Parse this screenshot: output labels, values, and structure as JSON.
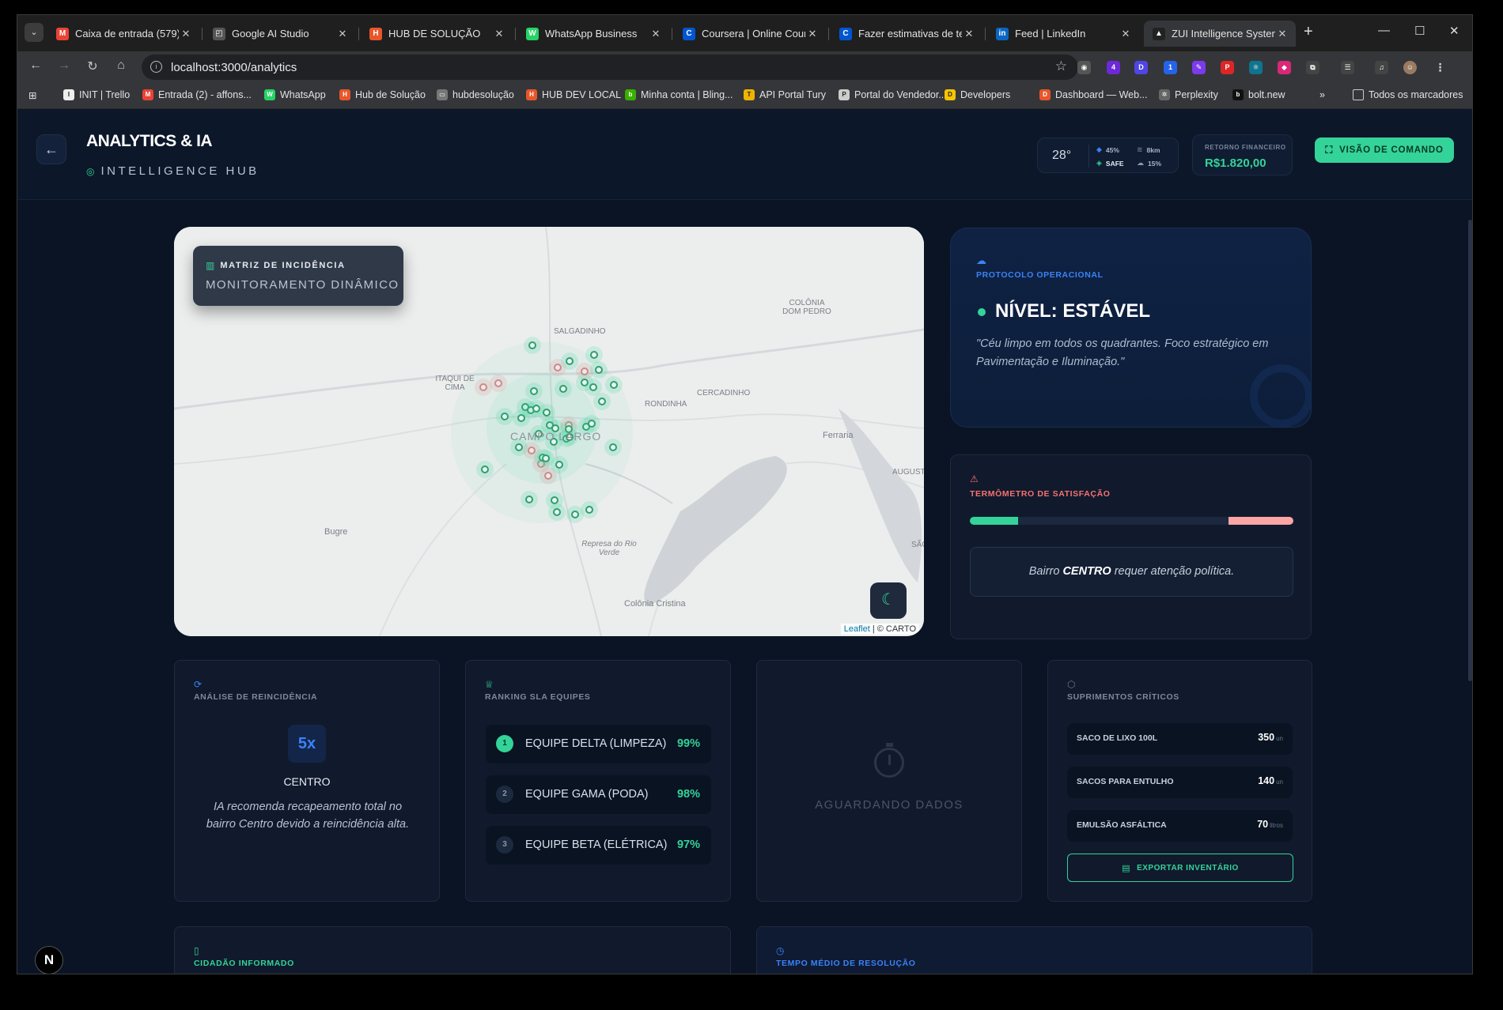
{
  "browser": {
    "tabs": [
      {
        "label": "Caixa de entrada (579)",
        "icon": "gmail-icon",
        "color": "#ea4335",
        "glyph": "M"
      },
      {
        "label": "Google AI Studio",
        "icon": "ai-studio-icon",
        "color": "#555555",
        "glyph": "◰"
      },
      {
        "label": "HUB DE SOLUÇÃO",
        "icon": "hub-icon",
        "color": "#e8562a",
        "glyph": "H"
      },
      {
        "label": "WhatsApp Business",
        "icon": "whatsapp-icon",
        "color": "#25d366",
        "glyph": "W"
      },
      {
        "label": "Coursera | Online Cours",
        "icon": "coursera-icon",
        "color": "#0056d2",
        "glyph": "C"
      },
      {
        "label": "Fazer estimativas de ter",
        "icon": "coursera-icon",
        "color": "#0056d2",
        "glyph": "C"
      },
      {
        "label": "Feed | LinkedIn",
        "icon": "linkedin-icon",
        "color": "#0a66c2",
        "glyph": "in"
      },
      {
        "label": "ZUI Intelligence System",
        "icon": "zui-icon",
        "color": "#222222",
        "glyph": "▲"
      }
    ],
    "url": "localhost:3000/analytics",
    "bookmarks": [
      {
        "label": "INIT | Trello",
        "color": "#eeeeee",
        "glyph": "I"
      },
      {
        "label": "Entrada (2) - affons...",
        "color": "#ea4335",
        "glyph": "M"
      },
      {
        "label": "WhatsApp",
        "color": "#25d366",
        "glyph": "W"
      },
      {
        "label": "Hub de Solução",
        "color": "#e8562a",
        "glyph": "H"
      },
      {
        "label": "hubdesolução",
        "color": "#777777",
        "glyph": "▭"
      },
      {
        "label": "HUB DEV LOCAL",
        "color": "#e8562a",
        "glyph": "H"
      },
      {
        "label": "Minha conta | Bling...",
        "color": "#38b000",
        "glyph": "b"
      },
      {
        "label": "API Portal Tury",
        "color": "#f0b400",
        "glyph": "T"
      },
      {
        "label": "Portal do Vendedor...",
        "color": "#cccccc",
        "glyph": "P"
      },
      {
        "label": "Developers",
        "color": "#f5c400",
        "glyph": "D"
      },
      {
        "label": "Dashboard — Web...",
        "color": "#e8562a",
        "glyph": "D"
      },
      {
        "label": "Perplexity",
        "color": "#666666",
        "glyph": "✲"
      },
      {
        "label": "bolt.new",
        "color": "#111111",
        "glyph": "b"
      }
    ],
    "more_bookmarks": "»",
    "all_bookmarks": "Todos os marcadores"
  },
  "header": {
    "title": "ANALYTICS & IA",
    "subtitle": "INTELLIGENCE HUB",
    "weather": {
      "temp": "28°",
      "humidity": "45%",
      "status": "SAFE",
      "wind": "8km",
      "rain": "15%"
    },
    "finance_label": "RETORNO FINANCEIRO",
    "finance_value": "R$1.820,00",
    "command_button": "VISÃO DE COMANDO"
  },
  "map": {
    "tag": "MATRIZ DE INCIDÊNCIA",
    "title": "MONITORAMENTO DINÂMICO",
    "places": [
      "SALGADINHO",
      "ITAQUI DE CIMA",
      "COLÔNIA DOM PEDRO",
      "CERCADINHO",
      "RONDINHA",
      "CAMPO LARGO",
      "Ferraria",
      "AUGUST",
      "SÃO",
      "Bugre",
      "Represa do Rio Verde",
      "Colônia Cristina"
    ],
    "attribution_link": "Leaflet",
    "attribution_rest": " | © CARTO"
  },
  "protocol": {
    "label": "PROTOCOLO OPERACIONAL",
    "level": "NÍVEL: ESTÁVEL",
    "quote": "\"Céu limpo em todos os quadrantes. Foco estratégico em Pavimentação e Iluminação.\""
  },
  "satisfaction": {
    "label": "TERMÔMETRO DE SATISFAÇÃO",
    "positive_fraction": 0.15,
    "negative_fraction": 0.2,
    "note_pre": "Bairro ",
    "note_bold": "CENTRO",
    "note_post": " requer atenção política."
  },
  "reincidence": {
    "label": "ANÁLISE DE REINCIDÊNCIA",
    "badge": "5x",
    "place": "CENTRO",
    "text": "IA recomenda recapeamento total no bairro Centro devido a reincidência alta."
  },
  "ranking": {
    "label": "RANKING SLA EQUIPES",
    "items": [
      {
        "pos": "1",
        "name": "EQUIPE DELTA (LIMPEZA)",
        "value": "99%"
      },
      {
        "pos": "2",
        "name": "EQUIPE GAMA (PODA)",
        "value": "98%"
      },
      {
        "pos": "3",
        "name": "EQUIPE BETA (ELÉTRICA)",
        "value": "97%"
      }
    ]
  },
  "awaiting": {
    "text": "AGUARDANDO DADOS"
  },
  "supplies": {
    "label": "SUPRIMENTOS CRÍTICOS",
    "items": [
      {
        "name": "SACO DE LIXO 100L",
        "value": "350",
        "unit": "un"
      },
      {
        "name": "SACOS PARA ENTULHO",
        "value": "140",
        "unit": "un"
      },
      {
        "name": "EMULSÃO ASFÁLTICA",
        "value": "70",
        "unit": "litros"
      }
    ],
    "export_button": "EXPORTAR INVENTÁRIO"
  },
  "citizen": {
    "label": "CIDADÃO INFORMADO"
  },
  "resolution": {
    "label": "TEMPO MÉDIO DE RESOLUÇÃO"
  },
  "dev_badge": "N",
  "colors": {
    "accent": "#34d399",
    "info": "#3b82f6",
    "alert": "#f87171",
    "background": "#0a1424"
  }
}
